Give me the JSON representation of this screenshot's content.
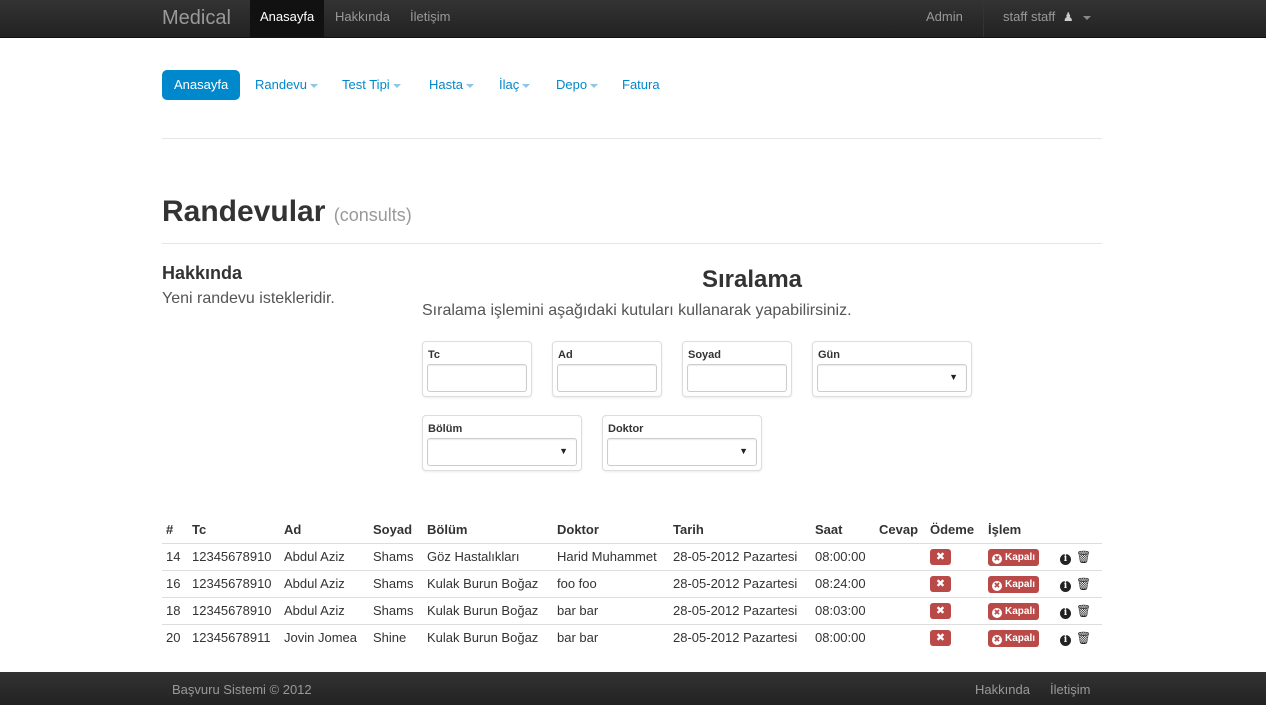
{
  "navbar": {
    "brand": "Medical",
    "items": [
      {
        "label": "Anasayfa"
      },
      {
        "label": "Hakkında"
      },
      {
        "label": "İletişim"
      }
    ],
    "admin": "Admin",
    "user": "staff staff"
  },
  "pills": [
    {
      "label": "Anasayfa"
    },
    {
      "label": "Randevu"
    },
    {
      "label": "Test Tipi"
    },
    {
      "label": "Hasta"
    },
    {
      "label": "İlaç"
    },
    {
      "label": "Depo"
    },
    {
      "label": "Fatura"
    }
  ],
  "page": {
    "title": "Randevular",
    "subtitle": "(consults)"
  },
  "about": {
    "title": "Hakkında",
    "text": "Yeni randevu istekleridir."
  },
  "sort": {
    "title": "Sıralama",
    "description": "Sıralama işlemini aşağıdaki kutuları kullanarak yapabilirsiniz.",
    "filters": {
      "tc": "Tc",
      "ad": "Ad",
      "soyad": "Soyad",
      "gun": "Gün",
      "bolum": "Bölüm",
      "doktor": "Doktor"
    }
  },
  "table": {
    "headers": [
      "#",
      "Tc",
      "Ad",
      "Soyad",
      "Bölüm",
      "Doktor",
      "Tarih",
      "Saat",
      "Cevap",
      "Ödeme",
      "İşlem"
    ],
    "status_label": "Kapalı",
    "rows": [
      {
        "id": "14",
        "tc": "12345678910",
        "ad": "Abdul Aziz",
        "soyad": "Shams",
        "bolum": "Göz Hastalıkları",
        "doktor": "Harid Muhammet",
        "tarih": "28-05-2012 Pazartesi",
        "saat": "08:00:00"
      },
      {
        "id": "16",
        "tc": "12345678910",
        "ad": "Abdul Aziz",
        "soyad": "Shams",
        "bolum": "Kulak Burun Boğaz",
        "doktor": "foo foo",
        "tarih": "28-05-2012 Pazartesi",
        "saat": "08:24:00"
      },
      {
        "id": "18",
        "tc": "12345678910",
        "ad": "Abdul Aziz",
        "soyad": "Shams",
        "bolum": "Kulak Burun Boğaz",
        "doktor": "bar bar",
        "tarih": "28-05-2012 Pazartesi",
        "saat": "08:03:00"
      },
      {
        "id": "20",
        "tc": "12345678911",
        "ad": "Jovin Jomea",
        "soyad": "Shine",
        "bolum": "Kulak Burun Boğaz",
        "doktor": "bar bar",
        "tarih": "28-05-2012 Pazartesi",
        "saat": "08:00:00"
      }
    ]
  },
  "footer": {
    "copyright": "Başvuru Sistemi © 2012",
    "links": [
      {
        "label": "Hakkında"
      },
      {
        "label": "İletişim"
      }
    ]
  },
  "colors": {
    "accent": "#0088cc",
    "danger": "#b94a48",
    "navbar": "#222222"
  }
}
